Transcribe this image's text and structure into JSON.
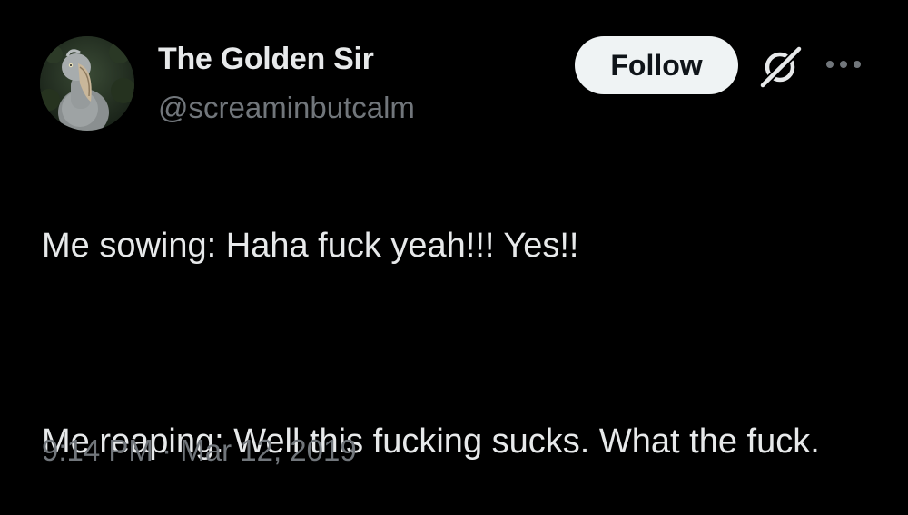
{
  "user": {
    "display_name": "The Golden Sir",
    "handle": "@screaminbutcalm",
    "avatar_icon": "shoebill-bird-avatar"
  },
  "actions": {
    "follow_label": "Follow",
    "grok_icon": "grok-icon",
    "more_icon": "more-icon"
  },
  "tweet": {
    "line1": "Me sowing: Haha fuck yeah!!! Yes!!",
    "line2": "Me reaping: Well this fucking sucks. What the fuck."
  },
  "meta": {
    "time": "9:14 PM",
    "separator": "·",
    "date": "Mar 12, 2019"
  },
  "colors": {
    "background": "#000000",
    "primary_text": "#e7e9ea",
    "secondary_text": "#71767b",
    "follow_bg": "#eff3f4",
    "follow_text": "#0f1419"
  }
}
